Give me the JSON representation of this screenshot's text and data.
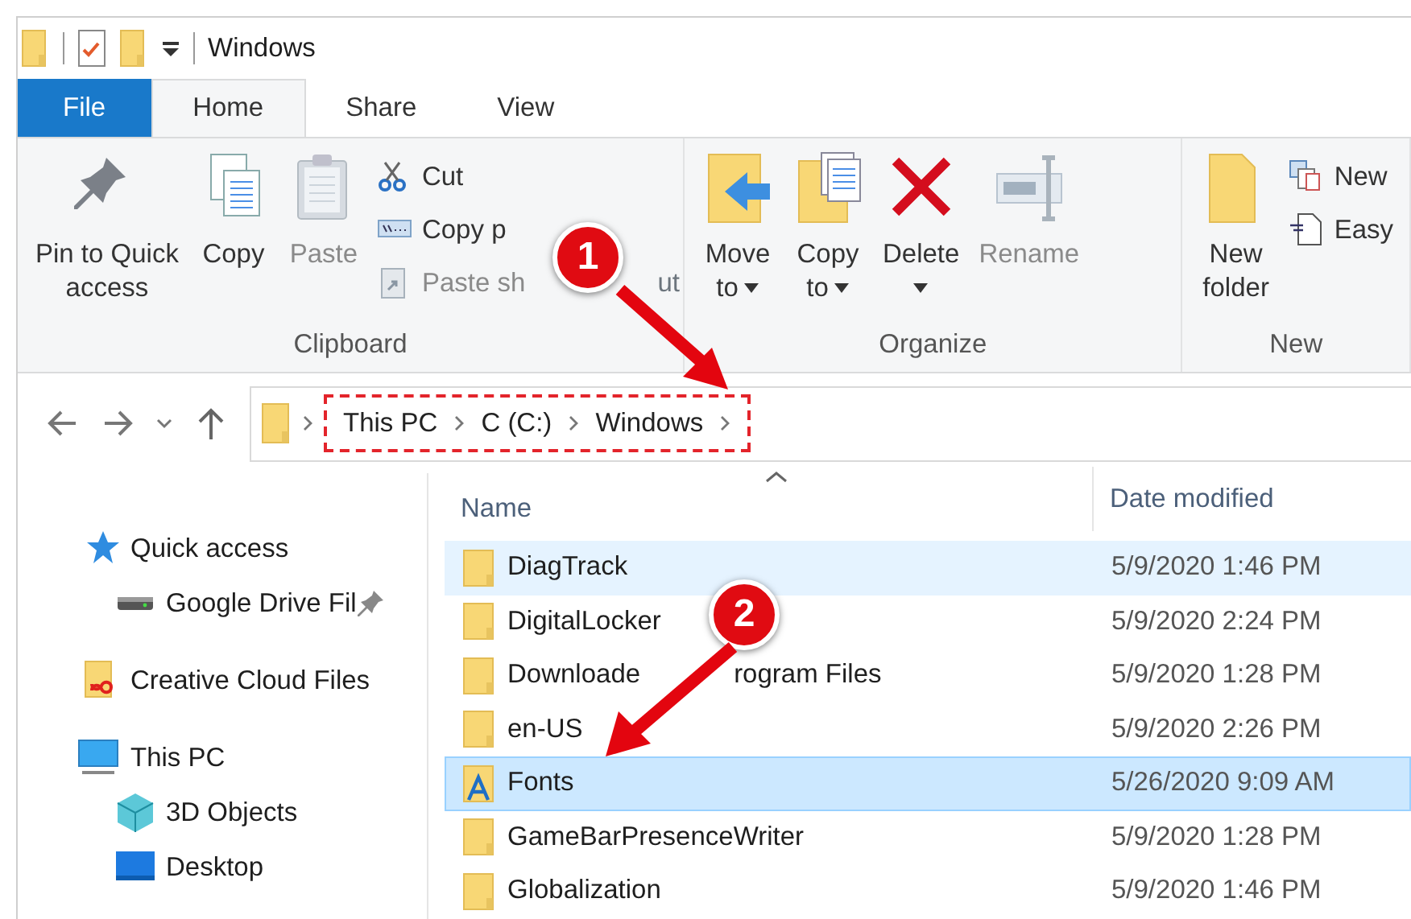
{
  "title_bar": {
    "title": "Windows"
  },
  "ribbon_tabs": [
    {
      "label": "File",
      "kind": "file",
      "selected": false
    },
    {
      "label": "Home",
      "kind": "tab",
      "selected": true
    },
    {
      "label": "Share",
      "kind": "tab",
      "selected": false
    },
    {
      "label": "View",
      "kind": "tab",
      "selected": false
    }
  ],
  "ribbon_groups": [
    {
      "name": "Clipboard",
      "large": [
        {
          "label": "Pin to Quick access",
          "disabled": false,
          "has_menu": false
        },
        {
          "label": "Copy",
          "disabled": false,
          "has_menu": false
        },
        {
          "label": "Paste",
          "disabled": true,
          "has_menu": false
        }
      ],
      "small": [
        {
          "label": "Cut",
          "disabled": false
        },
        {
          "label": "Copy p",
          "disabled": false
        },
        {
          "label": "Paste sh",
          "tail": "ut",
          "disabled": true
        }
      ]
    },
    {
      "name": "Organize",
      "large": [
        {
          "label": "Move to",
          "disabled": false,
          "has_menu": true
        },
        {
          "label": "Copy to",
          "disabled": false,
          "has_menu": true
        },
        {
          "label": "Delete",
          "disabled": false,
          "has_menu": true
        },
        {
          "label": "Rename",
          "disabled": true,
          "has_menu": false
        }
      ]
    },
    {
      "name": "New",
      "large": [
        {
          "label": "New folder",
          "disabled": false,
          "has_menu": false
        }
      ],
      "small": [
        {
          "label": "New",
          "disabled": false
        },
        {
          "label": "Easy",
          "disabled": false
        }
      ]
    }
  ],
  "address_bar": {
    "breadcrumbs": [
      "This PC",
      "C (C:)",
      "Windows"
    ],
    "highlighted": true
  },
  "navigation_pane": [
    {
      "label": "Quick access",
      "children": [
        {
          "label": "Google Drive Fil",
          "pinned": true
        }
      ]
    },
    {
      "label": "Creative Cloud Files"
    },
    {
      "label": "This PC",
      "children": [
        {
          "label": "3D Objects"
        },
        {
          "label": "Desktop"
        }
      ]
    }
  ],
  "file_list": {
    "columns": [
      "Name",
      "Date modified"
    ],
    "rows": [
      {
        "name": "DiagTrack",
        "date": "5/9/2020 1:46 PM",
        "kind": "folder",
        "hovered": true,
        "selected": false
      },
      {
        "name": "DigitalLocker",
        "date": "5/9/2020 2:24 PM",
        "kind": "folder",
        "hovered": false,
        "selected": false
      },
      {
        "name": "Downloade",
        "name_tail": "rogram Files",
        "date": "5/9/2020 1:28 PM",
        "kind": "folder",
        "hovered": false,
        "selected": false
      },
      {
        "name": "en-US",
        "date": "5/9/2020 2:26 PM",
        "kind": "folder",
        "hovered": false,
        "selected": false
      },
      {
        "name": "Fonts",
        "date": "5/26/2020 9:09 AM",
        "kind": "fonts",
        "hovered": false,
        "selected": true
      },
      {
        "name": "GameBarPresenceWriter",
        "date": "5/9/2020 1:28 PM",
        "kind": "folder",
        "hovered": false,
        "selected": false
      },
      {
        "name": "Globalization",
        "date": "5/9/2020 1:46 PM",
        "kind": "folder",
        "hovered": false,
        "selected": false
      }
    ]
  },
  "annotations": [
    {
      "kind": "callout",
      "label": "1"
    },
    {
      "kind": "callout",
      "label": "2"
    }
  ]
}
